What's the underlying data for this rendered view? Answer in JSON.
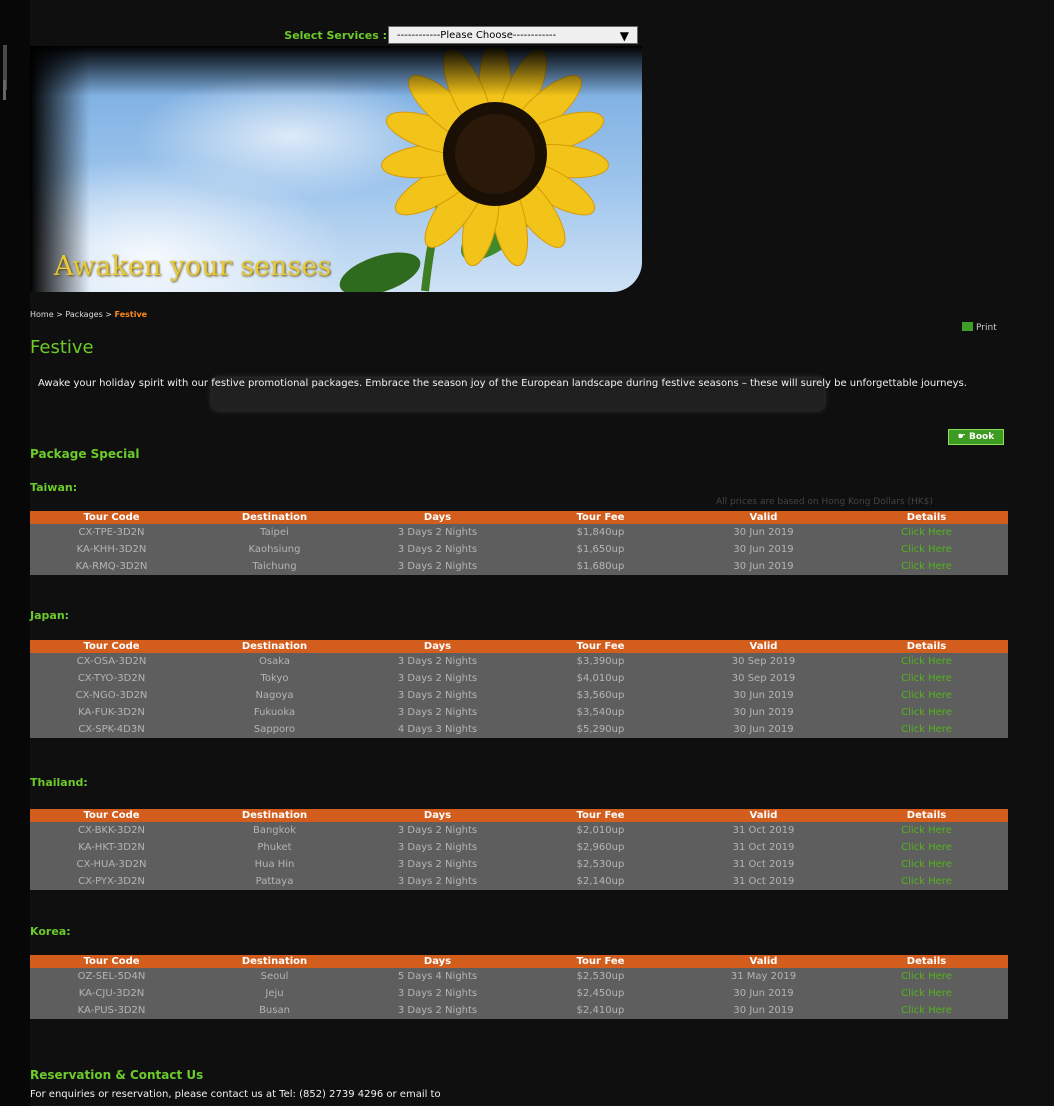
{
  "header": {
    "select_label": "Select Services :",
    "select_value": "------------Please Choose------------",
    "banner_slogan": "Awaken your senses"
  },
  "breadcrumb": {
    "home": "Home",
    "sep": ">",
    "packages": "Packages",
    "current": "Festive"
  },
  "page": {
    "print_label": "Print",
    "title": "Festive",
    "intro": "Awake your holiday spirit with our festive promotional packages. Embrace the season joy of the European landscape during festive seasons – these will surely be unforgettable journeys.",
    "book_label": "Book",
    "package_special": "Package Special",
    "note": "All prices are based on Hong Kong Dollars (HK$)"
  },
  "table_headers": [
    "Tour Code",
    "Destination",
    "Days",
    "Tour Fee",
    "Valid",
    "Details"
  ],
  "countries": [
    {
      "name": "Taiwan:",
      "rows": [
        [
          "CX-TPE-3D2N",
          "Taipei",
          "3 Days 2 Nights",
          "$1,840up",
          "30 Jun 2019",
          "Click Here"
        ],
        [
          "KA-KHH-3D2N",
          "Kaohsiung",
          "3 Days 2 Nights",
          "$1,650up",
          "30 Jun 2019",
          "Click Here"
        ],
        [
          "KA-RMQ-3D2N",
          "Taichung",
          "3 Days 2 Nights",
          "$1,680up",
          "30 Jun 2019",
          "Click Here"
        ]
      ]
    },
    {
      "name": "Japan:",
      "rows": [
        [
          "CX-OSA-3D2N",
          "Osaka",
          "3 Days 2 Nights",
          "$3,390up",
          "30 Sep 2019",
          "Click Here"
        ],
        [
          "CX-TYO-3D2N",
          "Tokyo",
          "3 Days 2 Nights",
          "$4,010up",
          "30 Sep 2019",
          "Click Here"
        ],
        [
          "CX-NGO-3D2N",
          "Nagoya",
          "3 Days 2 Nights",
          "$3,560up",
          "30 Jun 2019",
          "Click Here"
        ],
        [
          "KA-FUK-3D2N",
          "Fukuoka",
          "3 Days 2 Nights",
          "$3,540up",
          "30 Jun 2019",
          "Click Here"
        ],
        [
          "CX-SPK-4D3N",
          "Sapporo",
          "4 Days 3 Nights",
          "$5,290up",
          "30 Jun 2019",
          "Click Here"
        ]
      ]
    },
    {
      "name": "Thailand:",
      "rows": [
        [
          "CX-BKK-3D2N",
          "Bangkok",
          "3 Days 2 Nights",
          "$2,010up",
          "31 Oct 2019",
          "Click Here"
        ],
        [
          "KA-HKT-3D2N",
          "Phuket",
          "3 Days 2 Nights",
          "$2,960up",
          "31 Oct 2019",
          "Click Here"
        ],
        [
          "CX-HUA-3D2N",
          "Hua Hin",
          "3 Days 2 Nights",
          "$2,530up",
          "31 Oct 2019",
          "Click Here"
        ],
        [
          "CX-PYX-3D2N",
          "Pattaya",
          "3 Days 2 Nights",
          "$2,140up",
          "31 Oct 2019",
          "Click Here"
        ]
      ]
    },
    {
      "name": "Korea:",
      "rows": [
        [
          "OZ-SEL-5D4N",
          "Seoul",
          "5 Days 4 Nights",
          "$2,530up",
          "31 May 2019",
          "Click Here"
        ],
        [
          "KA-CJU-3D2N",
          "Jeju",
          "3 Days 2 Nights",
          "$2,450up",
          "30 Jun 2019",
          "Click Here"
        ],
        [
          "KA-PUS-3D2N",
          "Busan",
          "3 Days 2 Nights",
          "$2,410up",
          "30 Jun 2019",
          "Click Here"
        ]
      ]
    }
  ],
  "contact": {
    "title": "Reservation & Contact Us",
    "text": "For enquiries or reservation, please contact us at Tel: (852) 2739 4296 or email to"
  }
}
